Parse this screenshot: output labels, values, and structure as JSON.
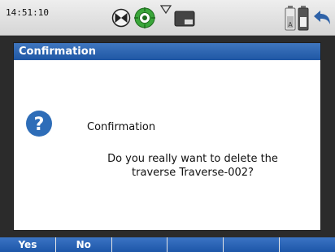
{
  "status_bar": {
    "time": "14:51:10",
    "icons": [
      "compass-icon",
      "target-icon",
      "signal-icon",
      "memory-card-icon",
      "battery-icon",
      "sd-card-icon",
      "back-arrow-icon"
    ]
  },
  "dialog": {
    "title": "Confirmation",
    "heading": "Confirmation",
    "message_line1": "Do you really want to delete the",
    "message_line2": "traverse Traverse-002?",
    "icon": "question-icon"
  },
  "softkeys": [
    {
      "label": "Yes"
    },
    {
      "label": "No"
    },
    {
      "label": ""
    },
    {
      "label": ""
    },
    {
      "label": ""
    },
    {
      "label": ""
    }
  ],
  "colors": {
    "title_blue": "#2a62b0",
    "softkey_blue": "#2a62b0",
    "question_blue": "#2e6db8",
    "target_green": "#3aa63a"
  }
}
